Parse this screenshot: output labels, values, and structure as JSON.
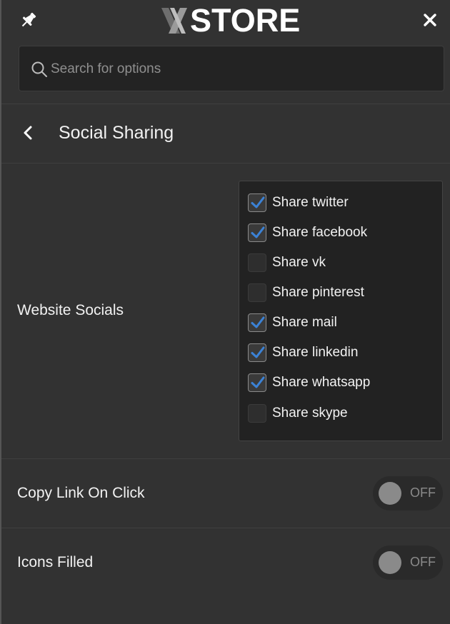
{
  "header": {
    "logo_text": "STORE",
    "pin_icon": "pin-icon",
    "close_icon": "close-icon"
  },
  "search": {
    "placeholder": "Search for options",
    "value": ""
  },
  "section": {
    "title": "Social Sharing",
    "back_icon": "chevron-left-icon"
  },
  "website_socials": {
    "label": "Website Socials",
    "options": [
      {
        "label": "Share twitter",
        "checked": true
      },
      {
        "label": "Share facebook",
        "checked": true
      },
      {
        "label": "Share vk",
        "checked": false
      },
      {
        "label": "Share pinterest",
        "checked": false
      },
      {
        "label": "Share mail",
        "checked": true
      },
      {
        "label": "Share linkedin",
        "checked": true
      },
      {
        "label": "Share whatsapp",
        "checked": true
      },
      {
        "label": "Share skype",
        "checked": false
      }
    ]
  },
  "copy_link": {
    "label": "Copy Link On Click",
    "state": "OFF"
  },
  "icons_filled": {
    "label": "Icons Filled",
    "state": "OFF"
  },
  "colors": {
    "background": "#323232",
    "check_accent": "#3b82d6",
    "toggle_off": "#8a8a8a"
  }
}
